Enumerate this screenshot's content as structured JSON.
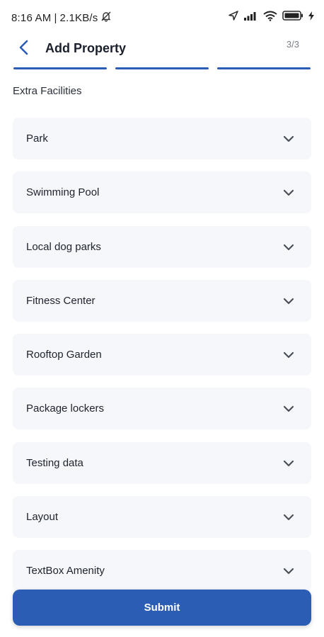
{
  "status_bar": {
    "time": "8:16 AM",
    "separator": "|",
    "speed": "2.1KB/s",
    "icons": [
      "mute-bell-icon",
      "location-arrow-icon",
      "signal-icon",
      "wifi-icon",
      "battery-icon",
      "charging-icon"
    ]
  },
  "header": {
    "title": "Add Property",
    "step": "3/3",
    "back_icon": "chevron-left-icon"
  },
  "progress": {
    "segments": 3,
    "completed": 3,
    "color": "#2b5db4"
  },
  "section": {
    "label": "Extra Facilities"
  },
  "facilities": [
    {
      "label": "Park"
    },
    {
      "label": "Swimming Pool"
    },
    {
      "label": "Local dog parks"
    },
    {
      "label": "Fitness Center"
    },
    {
      "label": "Rooftop Garden"
    },
    {
      "label": "Package lockers"
    },
    {
      "label": "Testing data"
    },
    {
      "label": "Layout"
    },
    {
      "label": "TextBox Amenity"
    }
  ],
  "submit": {
    "label": "Submit"
  },
  "colors": {
    "accent": "#2b5db4",
    "card_bg": "#f6f7fb",
    "text": "#20242e"
  }
}
